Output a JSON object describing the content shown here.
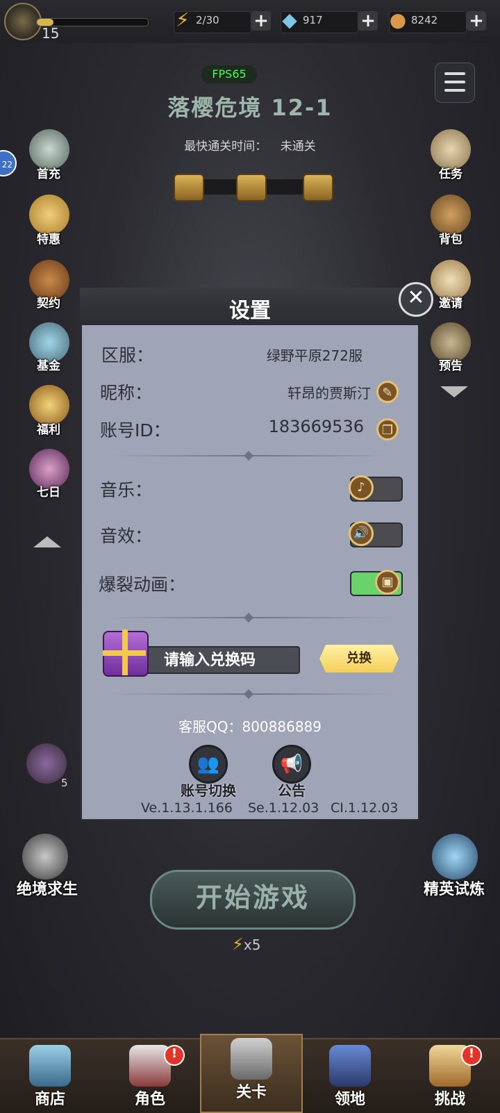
{
  "topbar": {
    "level": "15",
    "energy": "2/30",
    "diamonds": "917",
    "coins": "8242",
    "icons": {
      "energy": "lightning-icon",
      "diamond": "diamond-icon",
      "coin": "coin-icon",
      "plus": "plus-icon"
    }
  },
  "stage": {
    "fps": "FPS65",
    "title": "落樱危境 12-1",
    "fastest_label": "最快通关时间：",
    "fastest_value": "未通关"
  },
  "left_sidebar": {
    "badge": "22",
    "items": [
      {
        "label": "首充"
      },
      {
        "label": "特惠"
      },
      {
        "label": "契约"
      },
      {
        "label": "基金"
      },
      {
        "label": "福利"
      },
      {
        "label": "七日"
      }
    ],
    "partial_count": "5"
  },
  "right_sidebar": {
    "items": [
      {
        "label": "任务"
      },
      {
        "label": "背包"
      },
      {
        "label": "邀请"
      },
      {
        "label": "预告"
      }
    ]
  },
  "settings": {
    "title": "设置",
    "server_label": "区服：",
    "server_value": "绿野平原272服",
    "nickname_label": "昵称：",
    "nickname_value": "轩昂的贾斯汀",
    "account_label": "账号ID：",
    "account_value": "183669536",
    "music_label": "音乐：",
    "music_on": false,
    "sfx_label": "音效：",
    "sfx_on": false,
    "burst_label": "爆裂动画：",
    "burst_on": true,
    "redeem_placeholder": "请输入兑换码",
    "redeem_button": "兑换",
    "support": "客服QQ：800886889",
    "switch_account": "账号切换",
    "announcement": "公告",
    "version_ve": "Ve.1.13.1.166",
    "version_se": "Se.1.12.03",
    "version_ci": "CI.1.12.03"
  },
  "main": {
    "left_mode": "绝境求生",
    "right_mode": "精英试炼",
    "start_button": "开始游戏",
    "energy_cost": "x5"
  },
  "tabs": [
    {
      "label": "商店",
      "active": false,
      "alert": false
    },
    {
      "label": "角色",
      "active": false,
      "alert": true
    },
    {
      "label": "关卡",
      "active": true,
      "alert": false
    },
    {
      "label": "领地",
      "active": false,
      "alert": false
    },
    {
      "label": "挑战",
      "active": false,
      "alert": true
    }
  ],
  "colors": {
    "modal_bg": "#9fa4b6",
    "toggle_on": "#69d26b",
    "fps_green": "#4dff4d",
    "accent_gold": "#e2c27a"
  }
}
